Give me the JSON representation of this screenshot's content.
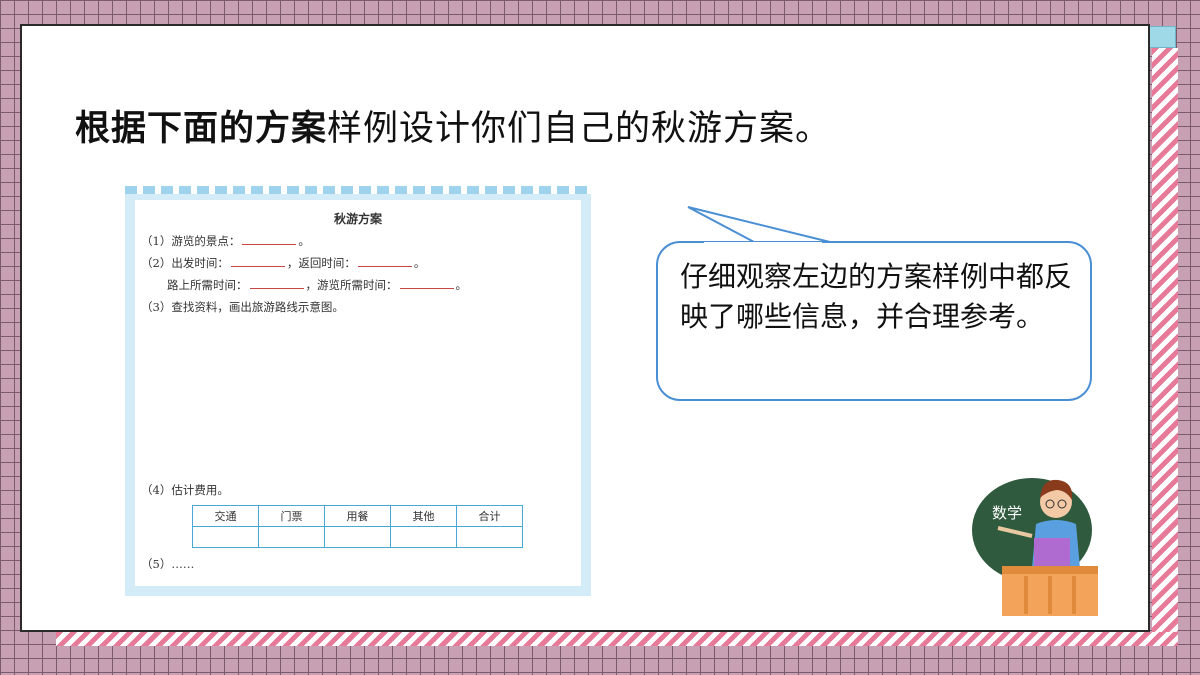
{
  "page": {
    "title_bold": "根据下面的方案",
    "title_rest": "样例设计你们自己的秋游方案。"
  },
  "sample": {
    "title": "秋游方案",
    "line1_a": "（1）游览的景点：",
    "line1_b": "。",
    "line2_a": "（2）出发时间：",
    "line2_b": "，返回时间：",
    "line2_c": "。",
    "line3_a": "路上所需时间：",
    "line3_b": "，游览所需时间：",
    "line3_c": "。",
    "line4": "（3）查找资料，画出旅游路线示意图。",
    "line5": "（4）估计费用。",
    "table_headers": [
      "交通",
      "门票",
      "用餐",
      "其他",
      "合计"
    ],
    "line6": "（5）……"
  },
  "bubble": {
    "text": "仔细观察左边的方案样例中都反映了哪些信息，并合理参考。"
  },
  "board": {
    "text": "数学"
  },
  "colors": {
    "bubble_border": "#4a8fd4",
    "card_frame": "#d4ecf7",
    "stripe_pink": "#e77a98",
    "board_green": "#2f5a3e"
  }
}
